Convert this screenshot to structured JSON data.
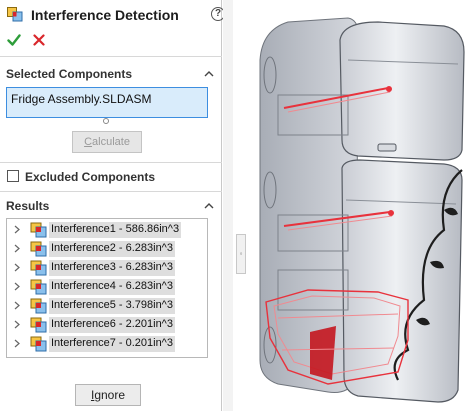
{
  "panel": {
    "title": "Interference Detection",
    "help_glyph": "?",
    "ok_icon": "green-check-icon",
    "cancel_icon": "red-x-icon"
  },
  "selected_components": {
    "title": "Selected Components",
    "value": "Fridge Assembly.SLDASM",
    "calculate_label": "Calculate",
    "calculate_mnemonic": "C",
    "calculate_rest": "alculate"
  },
  "excluded_components": {
    "title": "Excluded Components",
    "checked": false
  },
  "results": {
    "title": "Results",
    "items": [
      {
        "label": "Interference1 - 586.86in^3"
      },
      {
        "label": "Interference2 - 6.283in^3"
      },
      {
        "label": "Interference3 - 6.283in^3"
      },
      {
        "label": "Interference4 - 6.283in^3"
      },
      {
        "label": "Interference5 - 3.798in^3"
      },
      {
        "label": "Interference6 - 2.201in^3"
      },
      {
        "label": "Interference7 - 0.201in^3"
      }
    ],
    "ignore_label": "Ignore",
    "ignore_mnemonic": "I",
    "ignore_rest": "gnore"
  },
  "colors": {
    "accent": "#3d8ee0",
    "selection_bg": "#d9ecfb",
    "interference": "#e8323c",
    "ok": "#2e9d3a",
    "cancel": "#d9262b"
  }
}
